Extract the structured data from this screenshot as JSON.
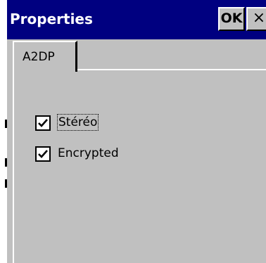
{
  "dialog": {
    "title": "Properties",
    "ok_label": "OK",
    "close_glyph": "×"
  },
  "tabs": [
    {
      "label": "A2DP",
      "selected": true
    }
  ],
  "options": [
    {
      "label": "Stéréo",
      "checked": true,
      "focused": true
    },
    {
      "label": "Encrypted",
      "checked": true,
      "focused": false
    }
  ],
  "colors": {
    "titlebar": "#000080",
    "face": "#c0c0c0",
    "highlight": "#ffffff",
    "shadow": "#000000"
  },
  "icons": {
    "checkmark": "check-icon",
    "close": "close-icon"
  }
}
